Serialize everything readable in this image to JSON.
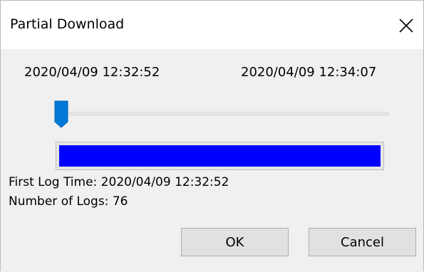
{
  "window": {
    "title": "Partial Download"
  },
  "range": {
    "start_time": "2020/04/09 12:32:52",
    "end_time": "2020/04/09 12:34:07"
  },
  "slider": {
    "position_fraction": 0.0
  },
  "progress": {
    "fill_fraction": 1.0,
    "fill_color": "#0000ff"
  },
  "info": {
    "first_log_line": "First Log Time: 2020/04/09 12:32:52",
    "count_line": "Number of Logs: 76"
  },
  "buttons": {
    "ok_label": "OK",
    "cancel_label": "Cancel"
  },
  "colors": {
    "thumb": "#0078d7",
    "background": "#f0f0f0"
  }
}
